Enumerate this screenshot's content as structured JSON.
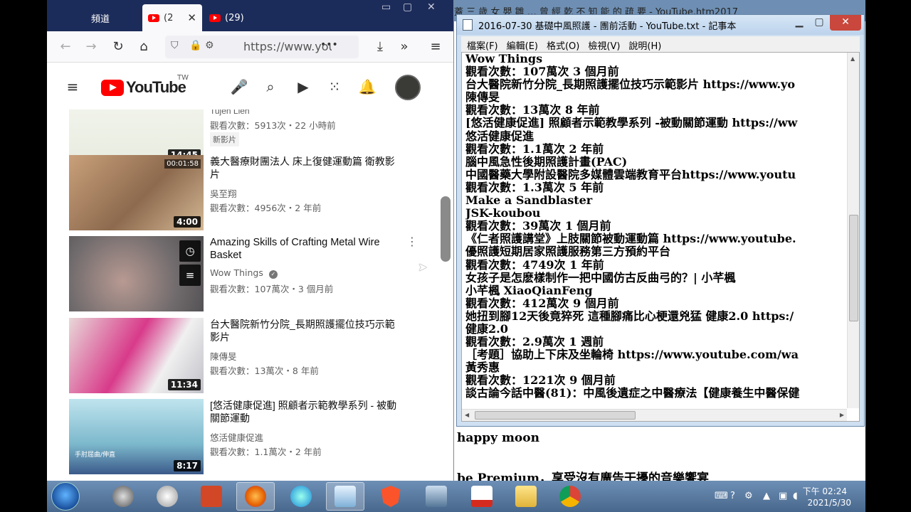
{
  "background_notepad": {
    "title": "蓋 三 歳 女 嬰 雛 … 曾 經 乾 不 知 能 的 疏 要 - YouTube.htm2017",
    "lines": [
      "happy moon",
      "be Premium，享受沒有廣告干擾的音樂饗宴"
    ]
  },
  "browser": {
    "tabs": [
      {
        "label": "頻道"
      },
      {
        "label": "(2"
      },
      {
        "label": "(29)"
      }
    ],
    "tab_close": "✕",
    "url": "https://www.you",
    "nav": {
      "back": "←",
      "forward": "→",
      "reload": "↻",
      "home": "⌂",
      "more": "•••",
      "overflow": "»",
      "menu": "≡"
    }
  },
  "youtube": {
    "logo": "YouTube",
    "region": "TW",
    "videos": [
      {
        "title": "Tujen Lien",
        "channel": "",
        "meta": "觀看次數：5913次・22 小時前",
        "duration": "14:45",
        "badge": "新影片"
      },
      {
        "title": "義大醫療財團法人 床上復健運動篇 衛教影片",
        "channel": "吳至翔",
        "meta": "觀看次數：4956次・2 年前",
        "duration": "4:00",
        "thumb_label": "00:01:58"
      },
      {
        "title": "Amazing Skills of Crafting Metal Wire Basket",
        "channel": "Wow Things",
        "meta": "觀看次數：107萬次・3 個月前",
        "duration": ""
      },
      {
        "title": "台大醫院新竹分院_長期照護擺位技巧示範影片",
        "channel": "陳傳旻",
        "meta": "觀看次數：13萬次・8 年前",
        "duration": "11:34"
      },
      {
        "title": "[悠活健康促進] 照顧者示範教學系列 - 被動關節運動",
        "channel": "悠活健康促進",
        "meta": "觀看次數：1.1萬次・2 年前",
        "duration": "8:17",
        "thumb_label": "手肘屈曲/伸直"
      }
    ]
  },
  "notepad": {
    "title": "2016-07-30 基礎中風照護 - 團前活動 - YouTube.txt - 記事本",
    "menu": [
      "檔案(F)",
      "編輯(E)",
      "格式(O)",
      "檢視(V)",
      "說明(H)"
    ],
    "lines": [
      "Wow Things",
      "觀看次數：107萬次 3 個月前",
      "台大醫院新竹分院_長期照護擺位技巧示範影片 https://www.yo",
      "陳傳旻",
      "觀看次數：13萬次 8 年前",
      "[悠活健康促進] 照顧者示範教學系列 -被動關節運動 https://ww",
      "悠活健康促進",
      "觀看次數：1.1萬次 2 年前",
      "腦中風急性後期照護計畫(PAC)",
      "中國醫藥大學附設醫院多媒體雲端教育平台https://www.youtu",
      "觀看次數：1.3萬次 5 年前",
      "Make a Sandblaster",
      "JSK-koubou",
      "觀看次數：39萬次 1 個月前",
      "《仁者照護講堂》上肢關節被動運動篇 https://www.youtube.",
      "優照護短期居家照護服務第三方預約平台",
      "觀看次數：4749次 1 年前",
      "女孩子是怎麽樣制作一把中國仿古反曲弓的？| 小芊楓",
      "小芊楓 XiaoQianFeng",
      "觀看次數：412萬次 9 個月前",
      "她扭到腳12天後竟猝死 這種腳痛比心梗還兇猛 健康2.0 https:/",
      "健康2.0",
      "觀看次數：2.9萬次 1 週前",
      "［考題］協助上下床及坐輪椅 https://www.youtube.com/wa",
      "黃秀惠",
      "觀看次數：1221次 9 個月前",
      "談古論今話中醫(81)：中風後遺症之中醫療法【健康養生中醫保健"
    ]
  },
  "taskbar": {
    "time": "下午 02:24",
    "date": "2021/5/30",
    "apps": [
      "start",
      "media-player",
      "settings",
      "powerpoint",
      "firefox",
      "ie",
      "notepad",
      "brave",
      "network",
      "pdf",
      "folder",
      "chrome"
    ]
  }
}
